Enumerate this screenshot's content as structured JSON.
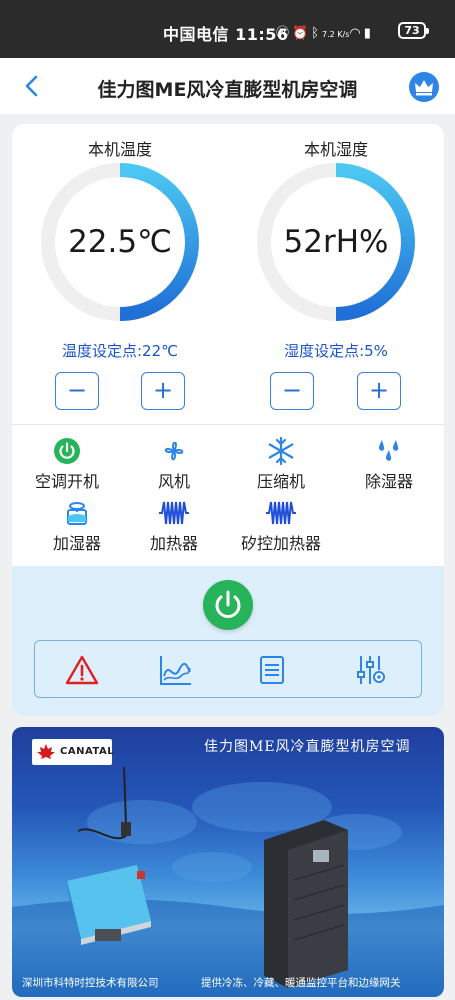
{
  "status_bar": {
    "carrier_time": "中国电信 11:56",
    "icons": [
      "nfc-icon",
      "alarm-icon",
      "bluetooth-icon",
      "net-speed-icon",
      "wifi-icon",
      "5g-signal-icon"
    ],
    "net_speed": "7.2 K/s",
    "battery": "73"
  },
  "nav": {
    "title": "佳力图ME风冷直膨型机房空调",
    "back_icon": "chevron-left-icon",
    "vip_icon": "crown-icon"
  },
  "temperature": {
    "title": "本机温度",
    "value": "22.5℃",
    "setpoint_label": "温度设定点:22℃",
    "minus": "−",
    "plus": "+"
  },
  "humidity": {
    "title": "本机湿度",
    "value": "52rH%",
    "setpoint_label": "湿度设定点:5%",
    "minus": "−",
    "plus": "+"
  },
  "devices": [
    {
      "label": "空调开机",
      "icon": "power-status-icon"
    },
    {
      "label": "风机",
      "icon": "fan-icon"
    },
    {
      "label": "压缩机",
      "icon": "snowflake-icon"
    },
    {
      "label": "除湿器",
      "icon": "water-drops-icon"
    },
    {
      "label": "加湿器",
      "icon": "humidifier-icon"
    },
    {
      "label": "加热器",
      "icon": "heater-coil-icon"
    },
    {
      "label": "矽控加热器",
      "icon": "scr-heater-icon"
    }
  ],
  "toolbar": [
    "alarm-warning-icon",
    "trend-chart-icon",
    "list-log-icon",
    "settings-sliders-icon"
  ],
  "banner": {
    "logo": "CANATAL",
    "title": "佳力图ME风冷直膨型机房空调",
    "footer_left": "深圳市科特时控技术有限公司",
    "footer_right": "提供冷冻、冷藏、暖通监控平台和边缘网关"
  },
  "colors": {
    "accent_blue": "#2d85e6",
    "power_green": "#27b35a",
    "alarm_red": "#e02020",
    "setpoint_text": "#1d55c6"
  }
}
